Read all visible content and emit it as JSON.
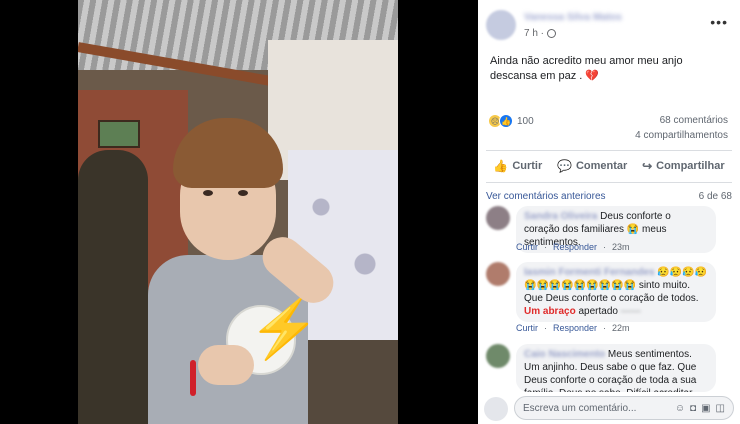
{
  "post": {
    "author": "Vanessa Silva Matos",
    "time": "7 h ·",
    "text": "Ainda não acredito meu amor meu anjo descansa em paz .",
    "heart": "💔"
  },
  "stats": {
    "reaction_count": "100",
    "comments": "68 comentários",
    "shares": "4 compartilhamentos"
  },
  "actions": {
    "like": "Curtir",
    "comment": "Comentar",
    "share": "Compartilhar"
  },
  "comments_header": {
    "more": "Ver comentários anteriores",
    "page": "6 de 68"
  },
  "comments": [
    {
      "name": "Sandra Oliveira",
      "text": "Deus conforte o coração dos familiares 😭 meus sentimentos.",
      "like": "Curtir",
      "reply": "Responder",
      "time": "23m"
    },
    {
      "name": "Iasmin Formenti Fernandes",
      "emoji": "😥😥😥😥",
      "text_a": "😭😭😭😭😭😭😭😭😭 sinto muito. Que Deus conforte o coração de todos. ",
      "text_red": "Um abraço",
      "text_b": " apertado",
      "like": "Curtir",
      "reply": "Responder",
      "time": "22m"
    },
    {
      "name": "Caio Nascimento",
      "text": "Meus sentimentos. Um anjinho. Deus sabe o que faz. Que Deus conforte o coração de toda a sua família. Deus no sabe. Difícil acreditar"
    }
  ],
  "composer": {
    "placeholder": "Escreva um comentário..."
  },
  "icons": {
    "more": "more-icon",
    "globe": "globe-icon",
    "like": "thumbs-up-icon",
    "comment": "speech-bubble-icon",
    "share": "share-arrow-icon"
  }
}
